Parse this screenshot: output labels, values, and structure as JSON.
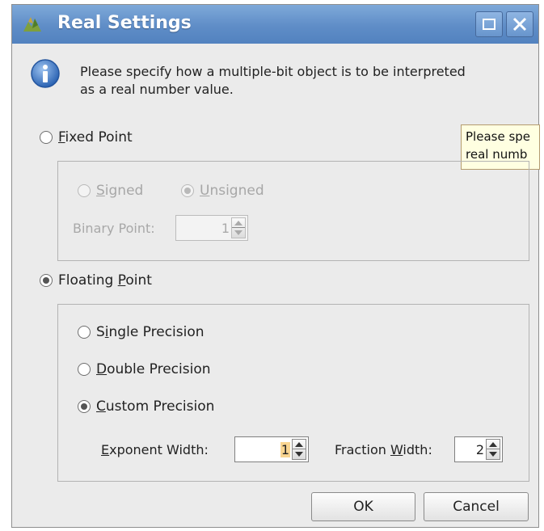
{
  "window": {
    "title": "Real Settings",
    "colors": {
      "titlebar": "#5f8dc7",
      "dialog_bg": "#ebebeb",
      "tooltip_bg": "#ffffe1",
      "highlight": "#f9d591"
    }
  },
  "message": "Please specify how a multiple-bit object is to be interpreted as a real number value.",
  "tooltip": {
    "line1": "Please spe",
    "line2": "real numb"
  },
  "fixed_point": {
    "label_m": "F",
    "label_rest": "ixed Point",
    "selected": false,
    "signed": {
      "m": "S",
      "rest": "igned",
      "selected": false,
      "enabled": false
    },
    "unsigned": {
      "m": "U",
      "rest": "nsigned",
      "selected": true,
      "enabled": false
    },
    "binary_point_label": "Binary Point:",
    "binary_point_value": "1"
  },
  "floating_point": {
    "label_pre": "Floating ",
    "label_m": "P",
    "label_rest": "oint",
    "selected": true,
    "single": {
      "pre": "S",
      "m": "i",
      "rest": "ngle Precision",
      "selected": false
    },
    "double": {
      "m": "D",
      "rest": "ouble Precision",
      "selected": false
    },
    "custom": {
      "m": "C",
      "rest": "ustom Precision",
      "selected": true
    },
    "exponent_label_m": "E",
    "exponent_label_rest": "xponent Width:",
    "exponent_value": "1",
    "fraction_label_pre": "Fraction ",
    "fraction_label_m": "W",
    "fraction_label_rest": "idth:",
    "fraction_value": "2"
  },
  "buttons": {
    "ok": "OK",
    "cancel": "Cancel"
  },
  "icons": [
    "app-icon",
    "maximize-icon",
    "close-icon",
    "info-icon",
    "spinner-arrows-icon"
  ]
}
